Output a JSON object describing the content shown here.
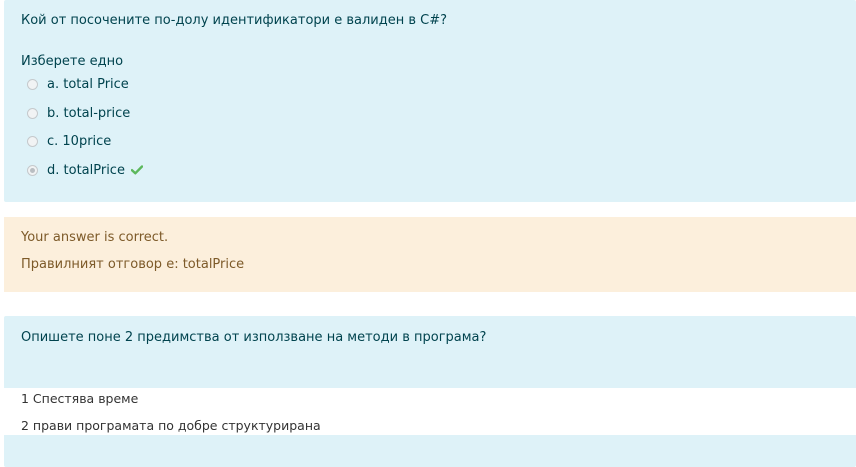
{
  "question1": {
    "text": "Кой от посочените по-долу идентификатори е валиден в C#?",
    "prompt": "Изберете едно",
    "options": [
      {
        "label": "a. total Price",
        "selected": false
      },
      {
        "label": "b. total-price",
        "selected": false
      },
      {
        "label": "c. 10price",
        "selected": false
      },
      {
        "label": "d. totalPrice",
        "selected": true,
        "correct_icon": "check-icon"
      }
    ]
  },
  "feedback": {
    "status": "Your answer is correct.",
    "right_answer": "Правилният отговор е: totalPrice"
  },
  "question2": {
    "text": "Опишете поне 2 предимства от използване на методи в програма?",
    "answer_lines": [
      "1 Спестява време",
      "2 прави програмата по добре структурирана"
    ]
  },
  "colors": {
    "question_bg": "#def2f8",
    "feedback_bg": "#fcefdc",
    "check": "#5cb85c"
  }
}
